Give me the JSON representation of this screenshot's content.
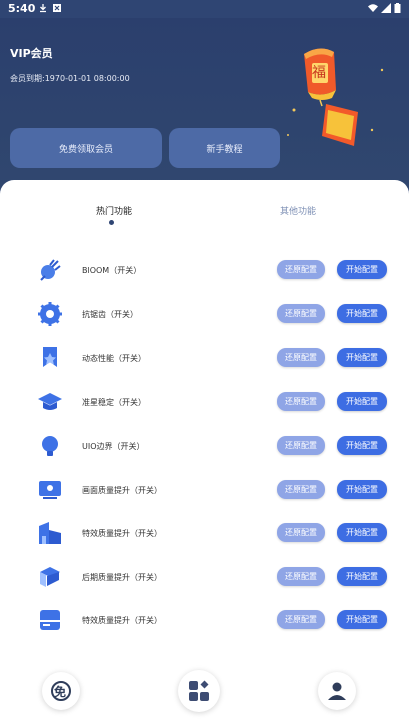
{
  "status_bar": {
    "time": "5:40"
  },
  "header": {
    "title": "VIP会员",
    "expire_label": "会员到期:",
    "expire_value": "1970-01-01 08:00:00",
    "free_vip_button": "免费领取会员",
    "tutorial_button": "新手教程",
    "lantern_text": "福"
  },
  "tabs": [
    {
      "label": "热门功能",
      "active": true
    },
    {
      "label": "其他功能",
      "active": false
    }
  ],
  "features": [
    {
      "label": "BlOOM（开关）",
      "icon": "plug-icon"
    },
    {
      "label": "抗锯齿（开关）",
      "icon": "gear-icon"
    },
    {
      "label": "动态性能（开关）",
      "icon": "star-bookmark-icon"
    },
    {
      "label": "准星稳定（开关）",
      "icon": "graduation-cap-icon"
    },
    {
      "label": "UIO边界（开关）",
      "icon": "bulb-icon"
    },
    {
      "label": "画面质量提升（开关）",
      "icon": "screen-icon"
    },
    {
      "label": "特效质量提升（开关）",
      "icon": "building-icon"
    },
    {
      "label": "后期质量提升（开关）",
      "icon": "layers-icon"
    },
    {
      "label": "特效质量提升（开关）",
      "icon": "card-icon"
    }
  ],
  "buttons": {
    "restore": "还原配置",
    "start": "开始配置"
  },
  "bottom_nav": [
    {
      "icon": "free-coupon-icon",
      "label": "免"
    },
    {
      "icon": "apps-grid-icon"
    },
    {
      "icon": "user-icon"
    }
  ],
  "colors": {
    "header_bg": "#2f4573",
    "accent": "#3d6de3",
    "restore": "#8fa5e6",
    "icon": "#3b6fe0"
  }
}
